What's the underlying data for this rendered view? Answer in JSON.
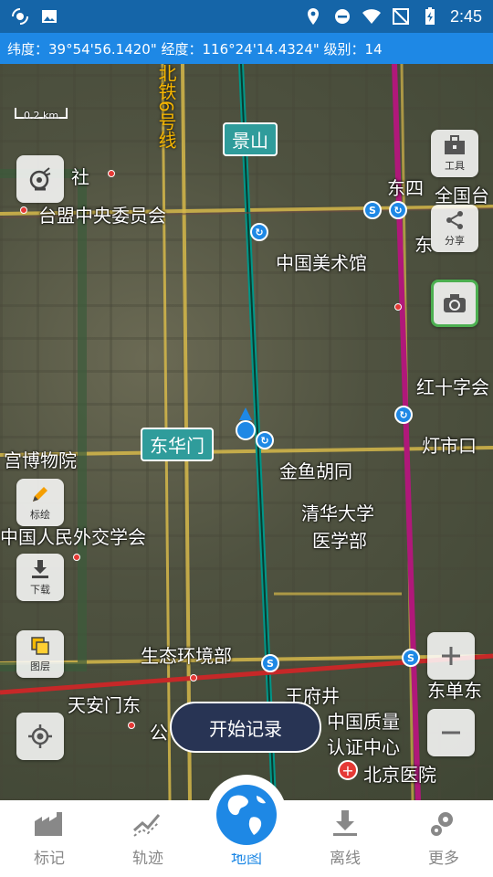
{
  "status_bar": {
    "time": "2:45"
  },
  "coord_bar": {
    "text": "纬度：39°54'56.1420\"  经度：116°24'14.4324\"  级别：14"
  },
  "map": {
    "scale_label": "0.2 km",
    "stations": {
      "jingshan": "景山",
      "donghuamen": "东华门"
    },
    "metro_line_label": "北铁6号线",
    "labels": {
      "l1": "台盟中央委员会",
      "l2": "中国美术馆",
      "l3": "东四",
      "l4": "全国台",
      "l5": "红十字会",
      "l6": "灯市口",
      "l7": "金鱼胡同",
      "l8": "清华大学",
      "l9": "医学部",
      "l10": "宫博物院",
      "l11": "中国人民外交学会",
      "l12": "生态环境部",
      "l13": "天安门东",
      "l14": "王府井",
      "l15": "中国质量",
      "l16": "认证中心",
      "l17": "北京医院",
      "l18": "东单东",
      "l19": "东",
      "l20": "社",
      "l21": "公"
    },
    "buttons": {
      "tools": "工具",
      "share": "分享",
      "annotate": "标绘",
      "download": "下载",
      "layers": "图层"
    },
    "record_label": "开始记录"
  },
  "bottom_nav": {
    "items": [
      {
        "label": "标记",
        "icon": "factory-icon"
      },
      {
        "label": "轨迹",
        "icon": "track-icon"
      },
      {
        "label": "地图",
        "icon": "globe-icon"
      },
      {
        "label": "离线",
        "icon": "download-icon"
      },
      {
        "label": "更多",
        "icon": "gears-icon"
      }
    ],
    "active": "地图"
  },
  "colors": {
    "status_bar": "#1565a8",
    "coord_bar": "#1e88e5",
    "accent": "#1e88e5",
    "record_button": "#283454",
    "metro_green": "#009688",
    "metro_magenta": "#b0187a",
    "metro_yellow": "#f4b400"
  }
}
